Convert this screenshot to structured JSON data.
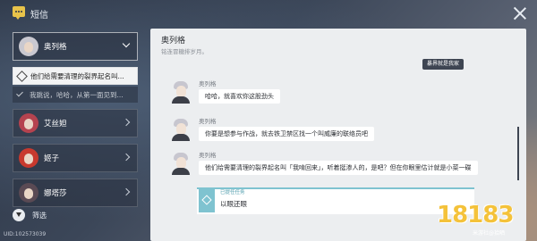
{
  "header": {
    "title": "短信"
  },
  "sidebar": {
    "contacts": [
      {
        "name": "奥列格",
        "expanded": true,
        "hair": "#3b3e49"
      },
      {
        "name": "艾丝妲",
        "expanded": false,
        "hair": "#b5434f"
      },
      {
        "name": "姬子",
        "expanded": false,
        "hair": "#c8392e"
      },
      {
        "name": "娜塔莎",
        "expanded": false,
        "hair": "#5a4a54"
      }
    ],
    "quests": [
      {
        "text": "他们给需要清理的裂界起名叫...",
        "state": "active"
      },
      {
        "text": "我跳说，哈哈，从第一面见到...",
        "state": "done"
      }
    ],
    "filter_label": "筛选",
    "uid": "UID:102573039"
  },
  "chat": {
    "contact_name": "奥列格",
    "contact_status": "铭连冒糖排岁月。",
    "tag": "暴界就是我家",
    "messages": [
      {
        "sender": "奥列格",
        "text": "哈哈，就喜欢你这股劲头"
      },
      {
        "sender": "奥列格",
        "text": "你要是想参与作战，就去铁卫禁区找一个叫威廉的联络员吧"
      },
      {
        "sender": "奥列格",
        "text": "他们给需要清理的裂界起名叫「我啃回来」，听着挺渗人的，是吧？但在你眼里估计就是小菜一碟"
      }
    ],
    "task": {
      "label": "已提任任务",
      "text": "以眼还眼"
    }
  },
  "watermark": {
    "text": "18183",
    "sub": "米游社@拾晒"
  },
  "colors": {
    "accent": "#7fc3d0",
    "app_icon": "#e8c34a",
    "watermark": "#f4c23a"
  }
}
